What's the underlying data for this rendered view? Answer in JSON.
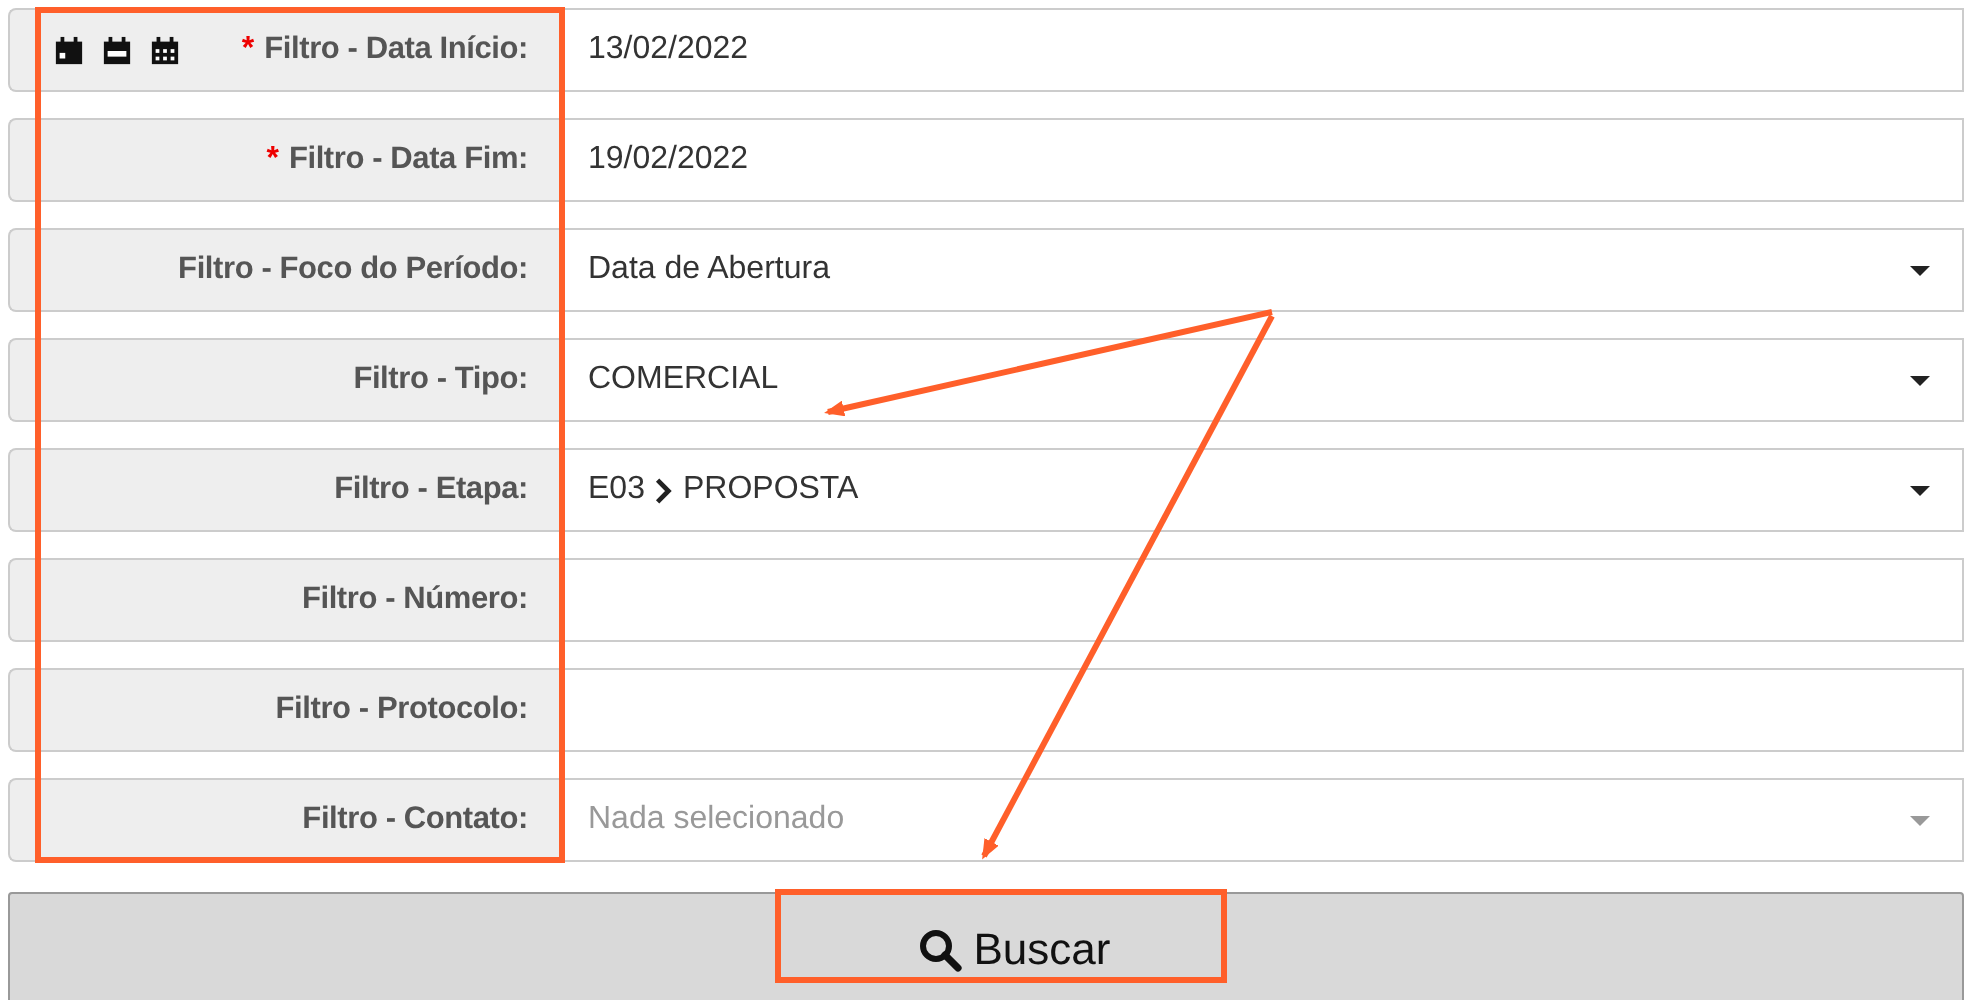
{
  "filters": [
    {
      "kind": "date",
      "label": "Filtro - Data Início:",
      "required_mark": "*",
      "calendar_icons": true,
      "value": "13/02/2022"
    },
    {
      "kind": "date",
      "label": "Filtro - Data Fim:",
      "required_mark": "*",
      "value": "19/02/2022"
    },
    {
      "kind": "select",
      "label": "Filtro - Foco do Período:",
      "value": "Data de Abertura"
    },
    {
      "kind": "select",
      "label": "Filtro - Tipo:",
      "value": "COMERCIAL"
    },
    {
      "kind": "select",
      "label": "Filtro - Etapa:",
      "code": "E03",
      "value": "PROPOSTA"
    },
    {
      "kind": "text",
      "label": "Filtro - Número:"
    },
    {
      "kind": "text",
      "label": "Filtro - Protocolo:"
    },
    {
      "kind": "select",
      "label": "Filtro - Contato:",
      "disabled": true,
      "placeholder": "Nada selecionado"
    }
  ],
  "search_button": {
    "label": "Buscar"
  }
}
